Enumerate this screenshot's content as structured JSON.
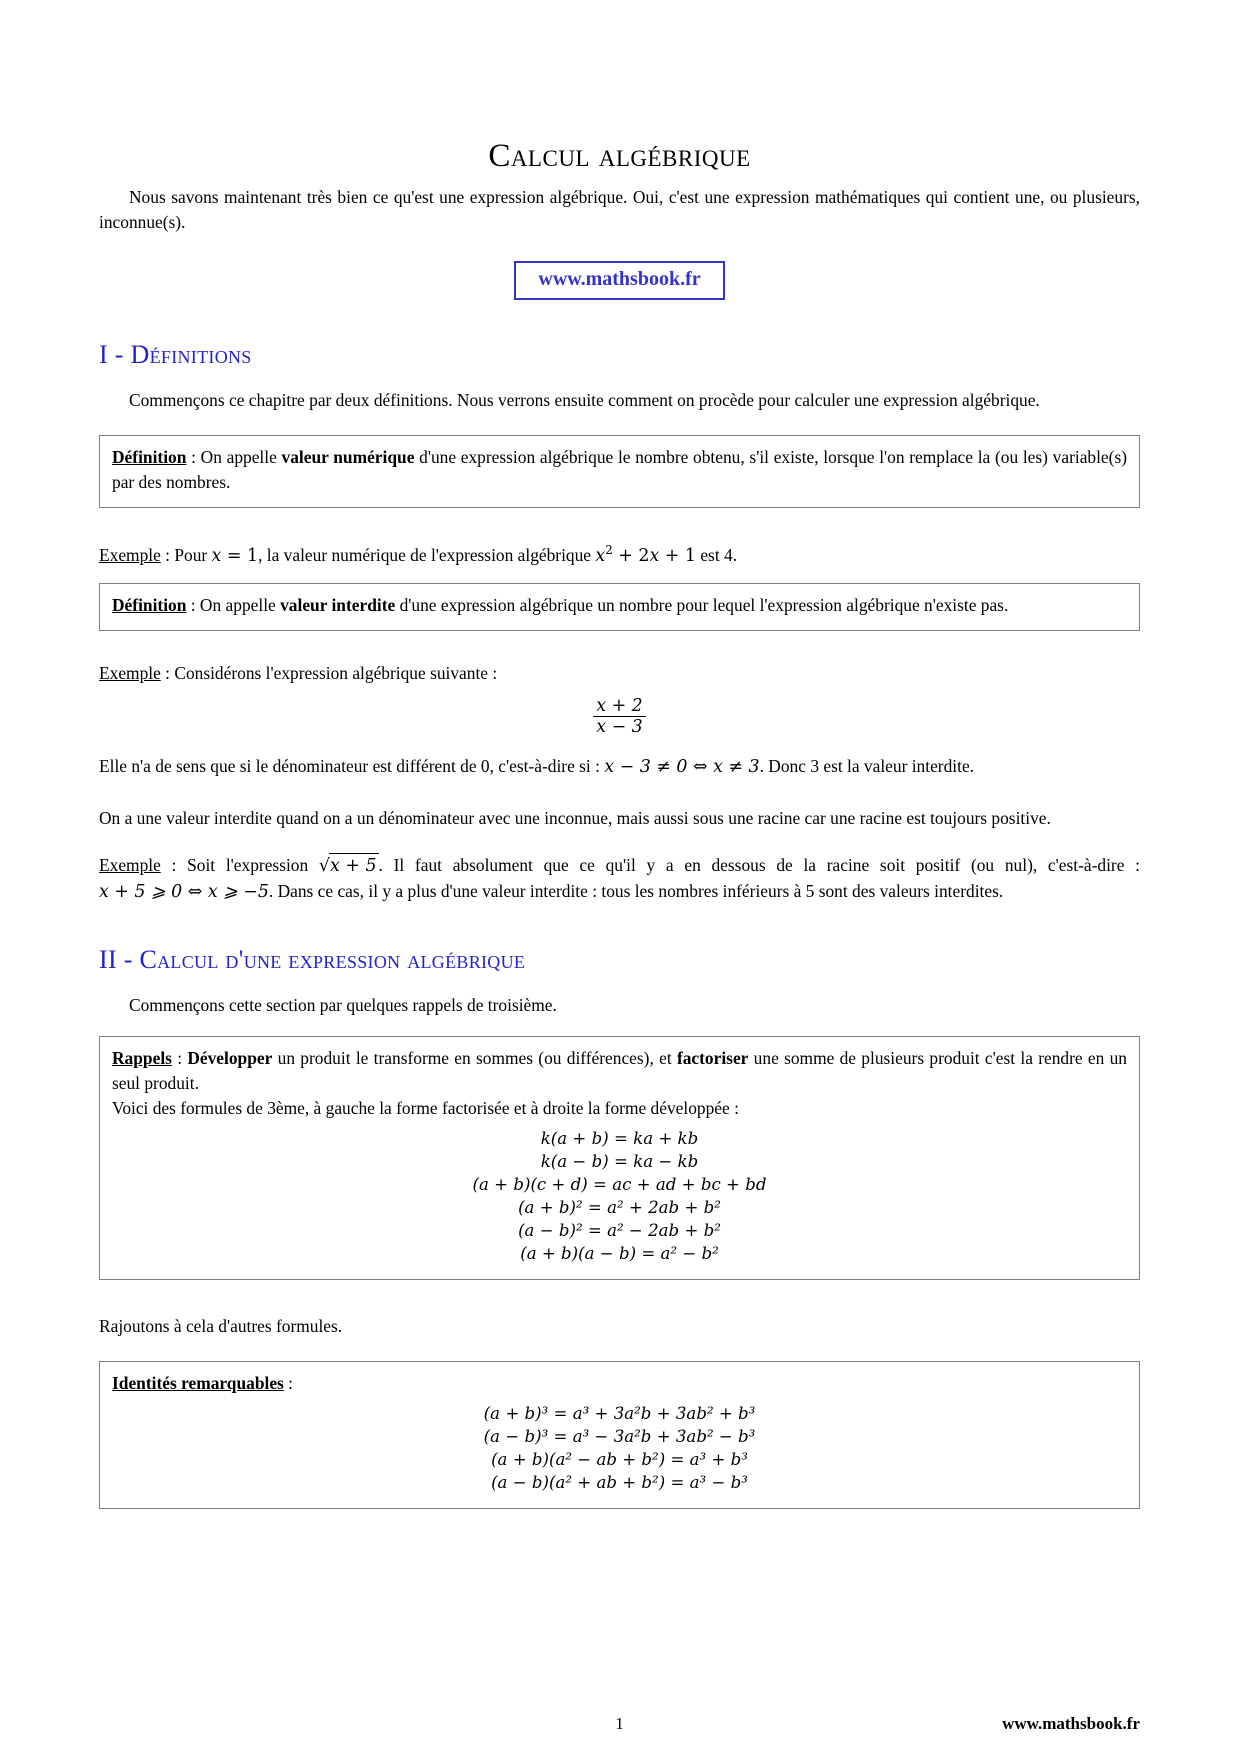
{
  "document": {
    "title": "Calcul algébrique",
    "intro": "Nous savons maintenant très bien ce qu'est une expression algébrique. Oui, c'est une expression mathématiques qui contient une, ou plusieurs, inconnue(s).",
    "url_badge": "www.mathsbook.fr"
  },
  "section1": {
    "number": "I - ",
    "heading": "Définitions",
    "intro": "Commençons ce chapitre par deux définitions. Nous verrons ensuite comment on procède pour calculer une expression algébrique.",
    "definition1": {
      "label": "Définition",
      "separator": " : On appelle ",
      "term": "valeur numérique",
      "body": " d'une expression algébrique le nombre obtenu, s'il existe, lorsque l'on remplace la (ou les) variable(s) par des nombres."
    },
    "example1": {
      "label": "Exemple",
      "text_before": " : Pour ",
      "math1": "x = 1",
      "text_middle": ", la valeur numérique de l'expression algébrique ",
      "math2": "x² + 2x + 1",
      "text_after": " est 4."
    },
    "definition2": {
      "label": "Définition",
      "separator": " : On appelle ",
      "term": "valeur interdite",
      "body": " d'une expression algébrique un nombre pour lequel l'expression algébrique n'existe pas."
    },
    "example2": {
      "label": "Exemple",
      "text": " : Considérons l'expression algébrique suivante :",
      "fraction_numerator": "x + 2",
      "fraction_denominator": "x − 3",
      "conclusion_before": "Elle n'a de sens que si le dénominateur est différent de 0, c'est-à-dire si : ",
      "conclusion_math": "x − 3 ≠ 0 ⇔ x ≠ 3",
      "conclusion_after": ". Donc 3 est la valeur interdite."
    },
    "paragraph_racine": "On a une valeur interdite quand on a un dénominateur avec une inconnue, mais aussi sous une racine car une racine est toujours positive.",
    "example3": {
      "label": "Exemple",
      "text_before": " : Soit l'expression ",
      "sqrt_content": "x + 5",
      "text_middle": ". Il faut absolument que ce qu'il y a en dessous de la racine soit positif (ou nul), c'est-à-dire : ",
      "math": "x + 5 ⩾ 0 ⇔ x ⩾ −5",
      "text_after": ". Dans ce cas, il y a plus d'une valeur interdite : tous les nombres inférieurs à 5 sont des valeurs interdites."
    }
  },
  "section2": {
    "number": "II - ",
    "heading": "Calcul d'une expression algébrique",
    "intro": "Commençons cette section par quelques rappels de troisième.",
    "rappels": {
      "label": "Rappels",
      "sep": " : ",
      "term1": "Développer",
      "text1": " un produit le transforme en sommes (ou différences), et ",
      "term2": "factoriser",
      "text2": " une somme de plusieurs produit c'est la rendre en un seul produit.",
      "line2": "Voici des formules de 3ème, à gauche la forme factorisée et à droite la forme développée :",
      "formulas": [
        "k(a + b) = ka + kb",
        "k(a − b) = ka − kb",
        "(a + b)(c + d) = ac + ad + bc + bd",
        "(a + b)² = a² + 2ab + b²",
        "(a − b)² = a² − 2ab + b²",
        "(a + b)(a − b) = a² − b²"
      ]
    },
    "bridge_text": "Rajoutons à cela d'autres formules.",
    "identites": {
      "label": "Identités remarquables",
      "sep": " :",
      "formulas": [
        "(a + b)³ = a³ + 3a²b + 3ab² + b³",
        "(a − b)³ = a³ − 3a²b + 3ab² − b³",
        "(a + b)(a² − ab + b²) = a³ + b³",
        "(a − b)(a² + ab + b²) = a³ − b³"
      ]
    }
  },
  "footer": {
    "page_number": "1",
    "site": "www.mathsbook.fr"
  },
  "colors": {
    "heading_blue": "#2222cc",
    "url_blue": "#3333cc",
    "box_border": "#808080",
    "text": "#000000"
  }
}
